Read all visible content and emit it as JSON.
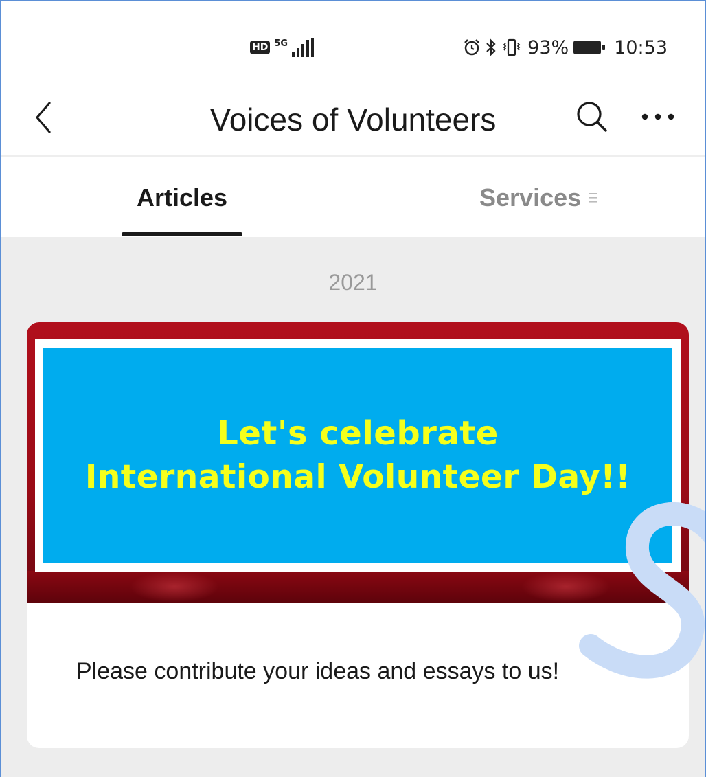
{
  "status_bar": {
    "hd_label": "HD",
    "network_type": "5G",
    "signal_icon": "signal-bars-icon",
    "alarm_icon": "alarm-clock-icon",
    "bluetooth_icon": "bluetooth-icon",
    "vibrate_icon": "vibrate-icon",
    "battery_percent": "93%",
    "battery_icon": "battery-icon",
    "time": "10:53"
  },
  "header": {
    "title": "Voices of Volunteers",
    "back_icon": "chevron-left-icon",
    "search_icon": "search-icon",
    "more_icon": "more-dots-icon"
  },
  "tabs": [
    {
      "label": "Articles",
      "active": true
    },
    {
      "label": "Services",
      "active": false,
      "icon": "menu-lines-icon"
    }
  ],
  "feed": {
    "year": "2021",
    "articles": [
      {
        "banner_line_1": "Let's celebrate",
        "banner_line_2": "International Volunteer Day!!",
        "text": "Please contribute your ideas and essays to us!"
      }
    ]
  },
  "colors": {
    "banner_red": "#b10f1c",
    "banner_blue": "#00acee",
    "banner_text_yellow": "#f5ff1c",
    "feed_background": "#ededed",
    "watermark_blue": "#c9dcf7"
  }
}
